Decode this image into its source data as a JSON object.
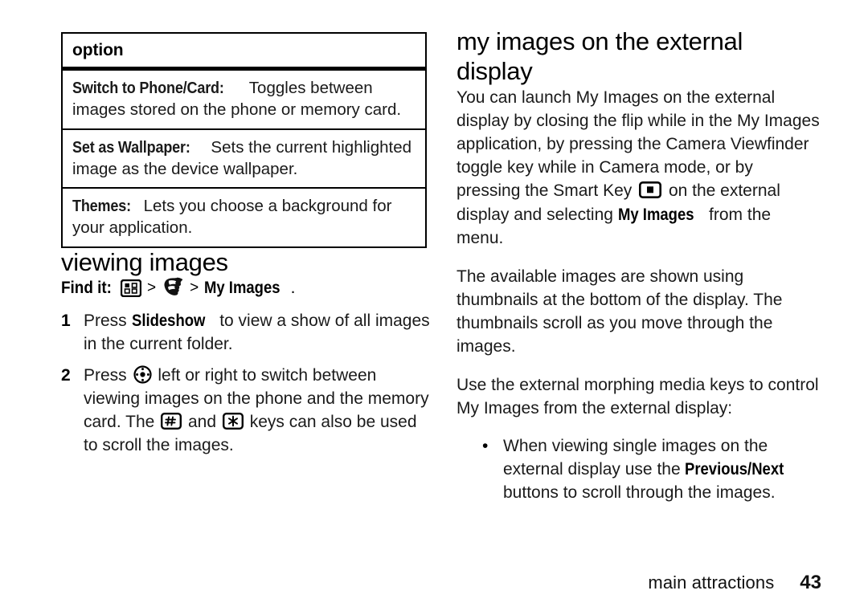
{
  "page": {
    "background": "#ffffff",
    "text_color": "#1a1a1a"
  },
  "options_table": {
    "header": "option",
    "rows": [
      {
        "term": "Switch to Phone/Card:",
        "description": " Toggles between images stored on the phone or memory card."
      },
      {
        "term": "Set as Wallpaper:",
        "description": " Sets the current highlighted image as the device wallpaper."
      },
      {
        "term": "Themes:",
        "description": " Lets you choose a background for your application."
      }
    ]
  },
  "viewing_images": {
    "heading": "viewing images",
    "find_it": {
      "label": "Find it:",
      "separator": ">",
      "icon_menu": "main-menu-icon",
      "icon_multimedia": "multimedia-icon",
      "target": "My Images",
      "period": "."
    },
    "steps": [
      {
        "number": "1",
        "text_before": "Press ",
        "keyword": "Slideshow",
        "text_after": " to view a show of all images in the current folder."
      },
      {
        "number": "2",
        "text_before": "Press ",
        "icon": "navigation-key-icon",
        "text_mid": " left or right to switch between viewing images on the phone and the memory card. The ",
        "icon2": "pound-key-icon",
        "text_mid2": " and ",
        "icon3": "star-key-icon",
        "text_after": " keys can also be used to scroll the images."
      }
    ]
  },
  "external_display": {
    "heading": "my images on the external display",
    "paragraph_1": {
      "part_1": "You can launch My Images on the external display by closing the flip while in the My Images application, by pressing the Camera Viewfinder toggle key while in Camera mode, or by pressing the Smart Key ",
      "icon": "smart-key-icon",
      "part_2": " on the external display and selecting ",
      "bold": "My Images",
      "part_3": " from the menu."
    },
    "paragraph_2": "The available images are shown using thumbnails at the bottom of the display. The thumbnails scroll as you move through the images.",
    "paragraph_3": "Use the external morphing media keys to control My Images from the external display:",
    "bullets": [
      {
        "marker": "•",
        "part_1": "When viewing single images on the external display use the ",
        "bold": "Previous/Next",
        "part_2": " buttons to scroll through the images."
      }
    ]
  },
  "footer": {
    "label": "main attractions",
    "page_number": "43"
  }
}
